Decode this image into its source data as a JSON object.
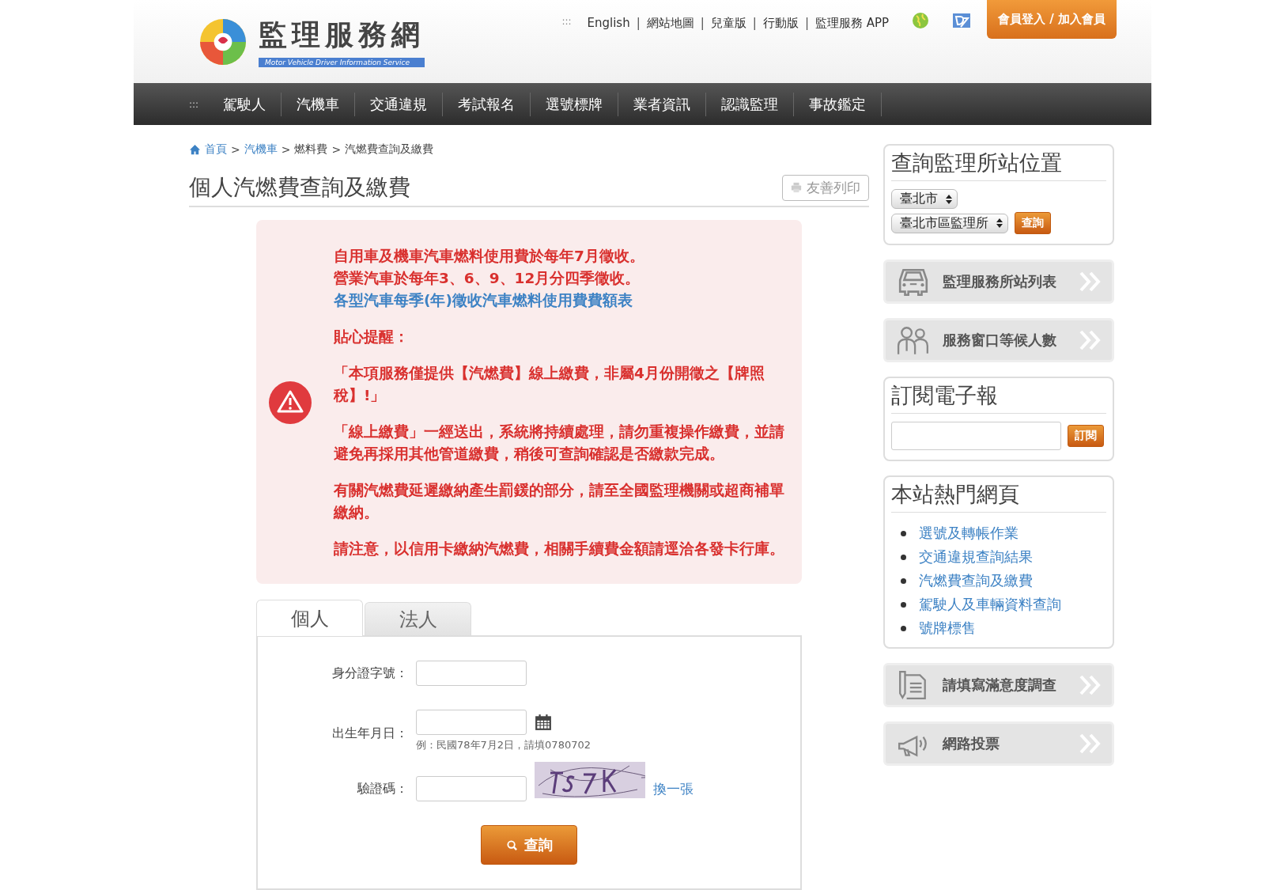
{
  "header": {
    "logo_title": "監理服務網",
    "logo_subtitle": "Motor Vehicle Driver Information Service",
    "separator": "|",
    "top_links": [
      "English",
      "網站地圖",
      "兒童版",
      "行動版",
      "監理服務 APP"
    ],
    "login_button": "會員登入 / 加入會員"
  },
  "nav": {
    "marker": ":::",
    "items": [
      "駕駛人",
      "汽機車",
      "交通違規",
      "考試報名",
      "選號標牌",
      "業者資訊",
      "認識監理",
      "事故鑑定"
    ]
  },
  "breadcrumb_separator": ">",
  "breadcrumb": [
    {
      "label": "首頁",
      "link": true
    },
    {
      "label": "汽機車",
      "link": true
    },
    {
      "label": "燃料費",
      "link": false
    },
    {
      "label": "汽燃費查詢及繳費",
      "link": false
    }
  ],
  "page_title": "個人汽燃費查詢及繳費",
  "print_button": "友善列印",
  "notice": [
    {
      "lines": [
        {
          "kind": "text",
          "text": "自用車及機車汽車燃料使用費於每年7月徵收。"
        },
        {
          "kind": "text",
          "text": "營業汽車於每年3、6、9、12月分四季徵收。"
        },
        {
          "kind": "link",
          "text": "各型汽車每季(年)徵收汽車燃料使用費費額表"
        }
      ]
    },
    {
      "lines": [
        {
          "kind": "text",
          "text": "貼心提醒："
        }
      ]
    },
    {
      "lines": [
        {
          "kind": "text",
          "text": "「本項服務僅提供【汽燃費】線上繳費，非屬4月份開徵之【牌照稅】!」"
        }
      ]
    },
    {
      "lines": [
        {
          "kind": "text",
          "text": "「線上繳費」一經送出，系統將持續處理，請勿重複操作繳費，並請避免再採用其他管道繳費，稍後可查詢確認是否繳款完成。"
        }
      ]
    },
    {
      "lines": [
        {
          "kind": "text",
          "text": "有關汽燃費延遲繳納產生罰鍰的部分，請至全國監理機關或超商補單繳納。"
        }
      ]
    },
    {
      "lines": [
        {
          "kind": "text",
          "text": "請注意，以信用卡繳納汽燃費，相關手續費金額請逕洽各發卡行庫。"
        }
      ]
    }
  ],
  "tabs": [
    {
      "label": "個人",
      "selected": true
    },
    {
      "label": "法人",
      "selected": false
    }
  ],
  "form": {
    "id_label": "身分證字號：",
    "birth_label": "出生年月日：",
    "birth_hint": "例：民國78年7月2日，請填0780702",
    "captcha_label": "驗證碼：",
    "refresh_link": "換一張",
    "submit": "查詢"
  },
  "sidebar": [
    {
      "kind": "location",
      "title": "查詢監理所站位置",
      "city": "臺北市",
      "office": "臺北市區監理所",
      "button": "查詢"
    },
    {
      "kind": "stations",
      "label": "監理服務所站列表"
    },
    {
      "kind": "queue",
      "label": "服務窗口等候人數"
    },
    {
      "kind": "subscribe",
      "title": "訂閱電子報",
      "button": "訂閱"
    },
    {
      "kind": "list",
      "title": "本站熱門網頁",
      "items": [
        "選號及轉帳作業",
        "交通違規查詢結果",
        "汽燃費查詢及繳費",
        "駕駛人及車輛資料查詢",
        "號牌標售"
      ]
    },
    {
      "kind": "survey",
      "label": "請填寫滿意度調查"
    },
    {
      "kind": "vote",
      "label": "網路投票"
    }
  ]
}
